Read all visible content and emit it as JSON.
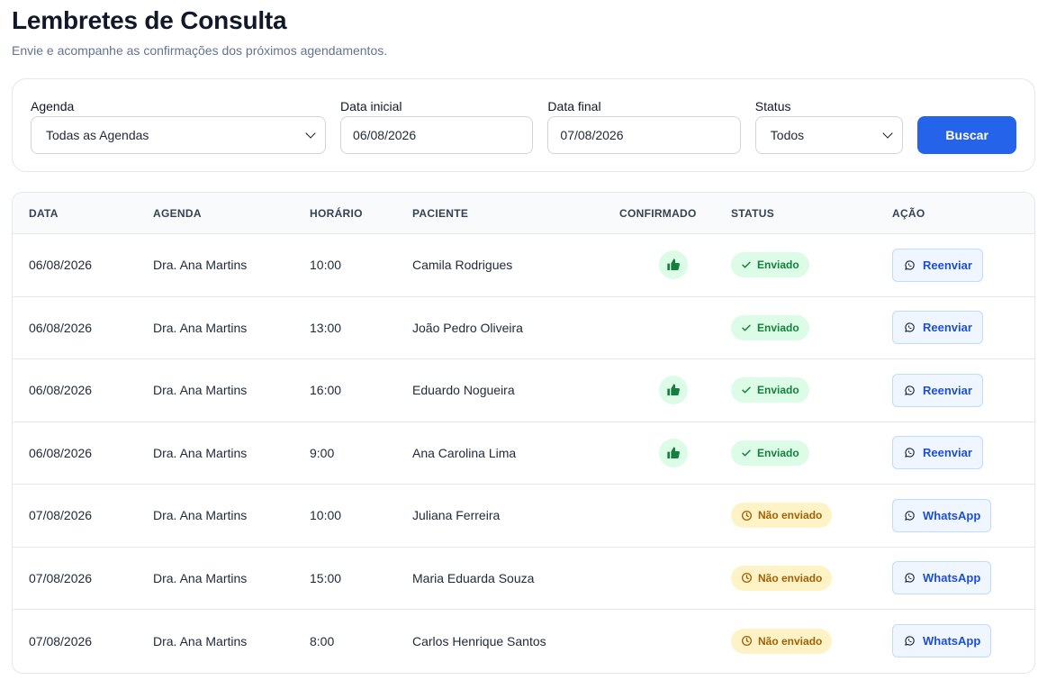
{
  "page": {
    "title": "Lembretes de Consulta",
    "subtitle": "Envie e acompanhe as confirmações dos próximos agendamentos."
  },
  "filters": {
    "agenda_label": "Agenda",
    "agenda_value": "Todas as Agendas",
    "start_label": "Data inicial",
    "start_value": "06/08/2026",
    "end_label": "Data final",
    "end_value": "07/08/2026",
    "status_label": "Status",
    "status_value": "Todos",
    "search_label": "Buscar"
  },
  "table": {
    "headers": [
      "DATA",
      "AGENDA",
      "HORÁRIO",
      "PACIENTE",
      "CONFIRMADO",
      "STATUS",
      "AÇÃO"
    ],
    "rows": [
      {
        "date": "06/08/2026",
        "agenda": "Dra. Ana Martins",
        "time": "10:00",
        "patient": "Camila Rodrigues",
        "confirmed": true,
        "status": "Enviado",
        "status_type": "sent",
        "action": "Reenviar"
      },
      {
        "date": "06/08/2026",
        "agenda": "Dra. Ana Martins",
        "time": "13:00",
        "patient": "João Pedro Oliveira",
        "confirmed": false,
        "status": "Enviado",
        "status_type": "sent",
        "action": "Reenviar"
      },
      {
        "date": "06/08/2026",
        "agenda": "Dra. Ana Martins",
        "time": "16:00",
        "patient": "Eduardo Nogueira",
        "confirmed": true,
        "status": "Enviado",
        "status_type": "sent",
        "action": "Reenviar"
      },
      {
        "date": "06/08/2026",
        "agenda": "Dra. Ana Martins",
        "time": "9:00",
        "patient": "Ana Carolina Lima",
        "confirmed": true,
        "status": "Enviado",
        "status_type": "sent",
        "action": "Reenviar"
      },
      {
        "date": "07/08/2026",
        "agenda": "Dra. Ana Martins",
        "time": "10:00",
        "patient": "Juliana Ferreira",
        "confirmed": false,
        "status": "Não enviado",
        "status_type": "notsent",
        "action": "WhatsApp"
      },
      {
        "date": "07/08/2026",
        "agenda": "Dra. Ana Martins",
        "time": "15:00",
        "patient": "Maria Eduarda Souza",
        "confirmed": false,
        "status": "Não enviado",
        "status_type": "notsent",
        "action": "WhatsApp"
      },
      {
        "date": "07/08/2026",
        "agenda": "Dra. Ana Martins",
        "time": "8:00",
        "patient": "Carlos Henrique Santos",
        "confirmed": false,
        "status": "Não enviado",
        "status_type": "notsent",
        "action": "WhatsApp"
      }
    ]
  },
  "icons": {
    "confirmed": "thumbs-up-icon",
    "sent": "check-icon",
    "notsent": "clock-icon",
    "action": "whatsapp-icon",
    "select": "chevron-down-icon"
  },
  "colors": {
    "primary": "#2563eb",
    "sent_bg": "#dcfce7",
    "sent_fg": "#15803d",
    "notsent_bg": "#fef3c7",
    "notsent_fg": "#a16207"
  }
}
